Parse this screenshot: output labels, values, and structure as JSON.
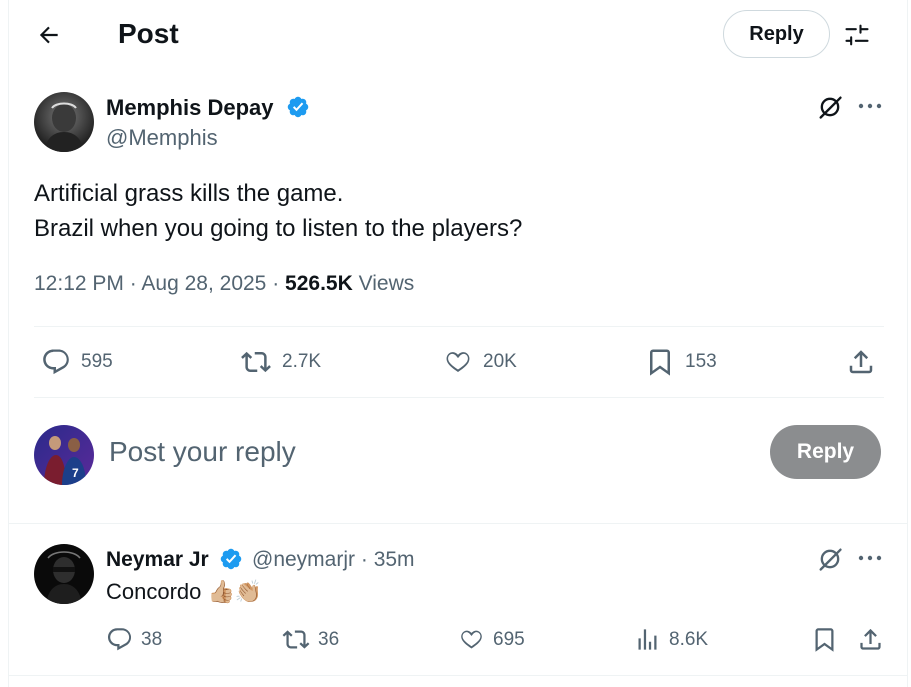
{
  "header": {
    "title": "Post",
    "reply_label": "Reply"
  },
  "post": {
    "author_name": "Memphis Depay",
    "author_handle": "@Memphis",
    "text_line1": "Artificial grass kills the game.",
    "text_line2": "Brazil when you going to listen to the players?",
    "time": "12:12 PM",
    "date": "Aug 28, 2025",
    "views_count": "526.5K",
    "views_label": "Views",
    "stats": {
      "replies": "595",
      "reposts": "2.7K",
      "likes": "20K",
      "bookmarks": "153"
    }
  },
  "compose": {
    "placeholder": "Post your reply",
    "reply_label": "Reply"
  },
  "reply": {
    "author_name": "Neymar Jr",
    "author_handle": "@neymarjr",
    "time": "35m",
    "text": "Concordo 👍🏼👏🏼",
    "stats": {
      "replies": "38",
      "reposts": "36",
      "likes": "695",
      "views": "8.6K"
    }
  },
  "colors": {
    "verified": "#1d9bf0",
    "text": "#0f1419",
    "secondary": "#536471",
    "reply_button_disabled": "#8b8d8f"
  },
  "icons": [
    "back-arrow-icon",
    "tune-icon",
    "grok-icon",
    "more-icon",
    "verified-icon",
    "reply-icon",
    "repost-icon",
    "like-icon",
    "bookmark-icon",
    "share-icon",
    "views-icon"
  ]
}
